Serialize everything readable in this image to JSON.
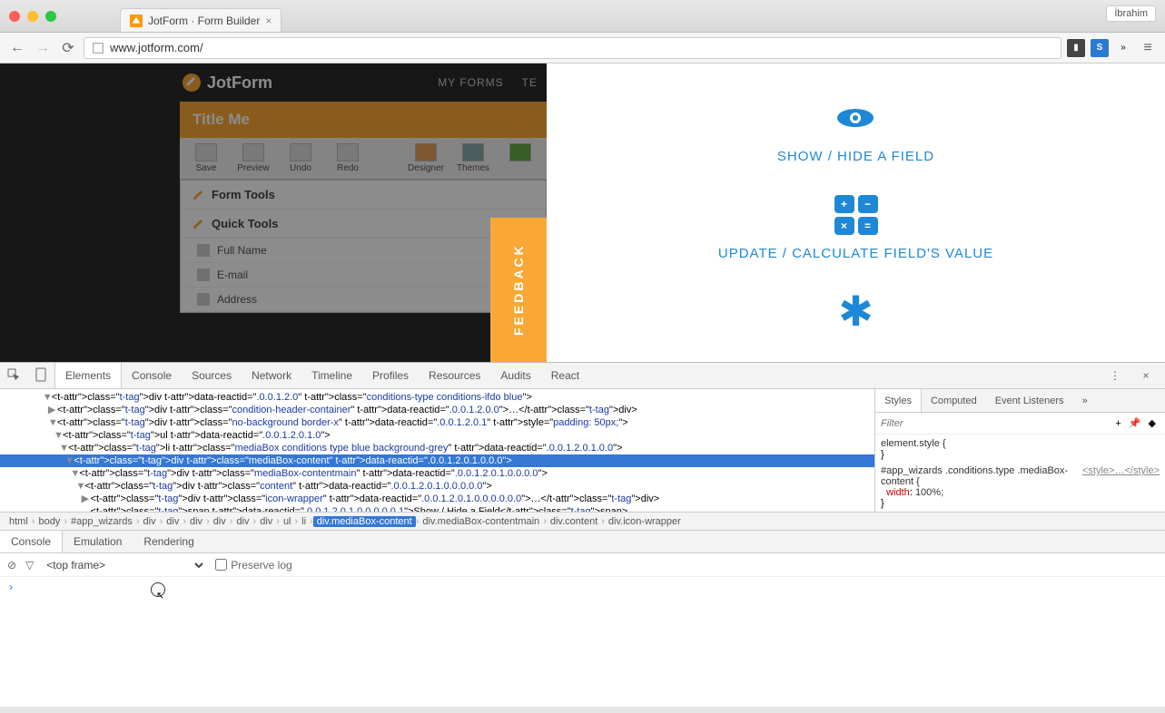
{
  "window": {
    "tab_title": "JotForm · Form Builder",
    "user_badge": "İbrahim"
  },
  "url_bar": {
    "url": "www.jotform.com/"
  },
  "jotform": {
    "brand": "JotForm",
    "nav": [
      "MY FORMS",
      "TE"
    ],
    "title": "Title Me",
    "tools": [
      {
        "label": "Save"
      },
      {
        "label": "Preview"
      },
      {
        "label": "Undo"
      },
      {
        "label": "Redo"
      },
      {
        "label": "Designer"
      },
      {
        "label": "Themes"
      }
    ],
    "sections": {
      "form_tools": "Form Tools",
      "quick_tools": "Quick Tools"
    },
    "items": [
      "Full Name",
      "E-mail",
      "Address"
    ],
    "feedback": "FEEDBACK"
  },
  "conditions": [
    {
      "label": "SHOW / HIDE A FIELD"
    },
    {
      "label": "UPDATE / CALCULATE FIELD'S VALUE"
    }
  ],
  "devtools": {
    "tabs": [
      "Elements",
      "Console",
      "Sources",
      "Network",
      "Timeline",
      "Profiles",
      "Resources",
      "Audits",
      "React"
    ],
    "active_tab": "Elements",
    "dom_lines": [
      {
        "indent": 7,
        "arrow": "▼",
        "html": "<div data-reactid=\".0.0.1.2.0\" class=\"conditions-type conditions-ifdo blue\">"
      },
      {
        "indent": 8,
        "arrow": "▶",
        "html": "<div class=\"condition-header-container\" data-reactid=\".0.0.1.2.0.0\">…</div>"
      },
      {
        "indent": 8,
        "arrow": "▼",
        "html": "<div class=\"no-background border-x\" data-reactid=\".0.0.1.2.0.1\" style=\"padding: 50px;\">"
      },
      {
        "indent": 9,
        "arrow": "▼",
        "html": "<ul data-reactid=\".0.0.1.2.0.1.0\">"
      },
      {
        "indent": 10,
        "arrow": "▼",
        "html": "<li class=\"mediaBox conditions type blue background-grey\" data-reactid=\".0.0.1.2.0.1.0.0\">"
      },
      {
        "indent": 11,
        "arrow": "▼",
        "sel": true,
        "html": "<div class=\"mediaBox-content\" data-reactid=\".0.0.1.2.0.1.0.0.0\">"
      },
      {
        "indent": 12,
        "arrow": "▼",
        "html": "<div class=\"mediaBox-contentmain\" data-reactid=\".0.0.1.2.0.1.0.0.0.0\">"
      },
      {
        "indent": 13,
        "arrow": "▼",
        "html": "<div class=\"content\" data-reactid=\".0.0.1.2.0.1.0.0.0.0.0\">"
      },
      {
        "indent": 14,
        "arrow": "▶",
        "html": "<div class=\"icon-wrapper\" data-reactid=\".0.0.1.2.0.1.0.0.0.0.0.0\">…</div>"
      },
      {
        "indent": 14,
        "arrow": "",
        "html": "<span data-reactid=\".0.0.1.2.0.1.0.0.0.0.0.1\">Show / Hide a Field</span>"
      }
    ],
    "breadcrumb": [
      "html",
      "body",
      "#app_wizards",
      "div",
      "div",
      "div",
      "div",
      "div",
      "div",
      "ul",
      "li",
      "div.mediaBox-content",
      "div.mediaBox-contentmain",
      "div.content",
      "div.icon-wrapper"
    ],
    "breadcrumb_active": 11,
    "styles_tabs": [
      "Styles",
      "Computed",
      "Event Listeners"
    ],
    "styles_filter_placeholder": "Filter",
    "styles": {
      "inline": "element.style {",
      "rule_sel": "#app_wizards .conditions.type .mediaBox-content {",
      "rule_src": "<style>…</style>",
      "rule_props": [
        {
          "prop": "width",
          "val": "100%;"
        }
      ]
    },
    "console_tabs": [
      "Console",
      "Emulation",
      "Rendering"
    ],
    "frame": "<top frame>",
    "preserve_label": "Preserve log"
  }
}
